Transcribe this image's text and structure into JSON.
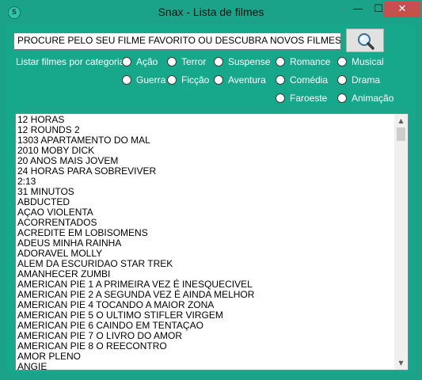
{
  "window": {
    "title": "Snax - Lista de filmes",
    "app_icon_glyph": "S",
    "minimize_glyph": "—",
    "maximize_glyph": "☐",
    "close_glyph": "✕"
  },
  "search": {
    "value": "PROCURE PELO SEU FILME FAVORITO OU DESCUBRA NOVOS FILMES!",
    "button_icon": "magnifier-icon"
  },
  "categories": {
    "label": "Listar filmes por categoria:",
    "options": [
      {
        "label": "Ação",
        "selected": false
      },
      {
        "label": "Terror",
        "selected": false
      },
      {
        "label": "Suspense",
        "selected": false
      },
      {
        "label": "Romance",
        "selected": false
      },
      {
        "label": "Musical",
        "selected": false
      },
      {
        "label": "Guerra",
        "selected": false
      },
      {
        "label": "Ficção",
        "selected": false
      },
      {
        "label": "Aventura",
        "selected": false
      },
      {
        "label": "Comédia",
        "selected": false
      },
      {
        "label": "Drama",
        "selected": false
      },
      {
        "label": "Faroeste",
        "selected": false
      },
      {
        "label": "Animação",
        "selected": false
      }
    ]
  },
  "movies": [
    "12 HORAS",
    "12 ROUNDS 2",
    "1303 APARTAMENTO DO MAL",
    "2010 MOBY DICK",
    "20 ANOS MAIS JOVEM",
    "24 HORAS PARA SOBREVIVER",
    "2:13",
    "31 MINUTOS",
    "ABDUCTED",
    "AÇAO VIOLENTA",
    "ACORRENTADOS",
    "ACREDITE EM LOBISOMENS",
    "ADEUS MINHA RAINHA",
    "ADORAVEL MOLLY",
    "ALEM DA ESCURIDAO STAR TREK",
    "AMANHECER ZUMBI",
    "AMERICAN PIE 1 A PRIMEIRA VEZ É INESQUECIVEL",
    "AMERICAN PIE 2 A SEGUNDA VEZ É AINDA MELHOR",
    "AMERICAN PIE 4 TOCANDO A MAIOR ZONA",
    "AMERICAN PIE 5 O ULTIMO STIFLER VIRGEM",
    "AMERICAN PIE 6 CAINDO EM TENTAÇAO",
    "AMERICAN PIE 7 O LIVRO DO AMOR",
    "AMERICAN PIE 8 O REECONTRO",
    "AMOR PLENO",
    "ANGIE"
  ],
  "scrollbar": {
    "up_glyph": "▲",
    "down_glyph": "▼"
  },
  "colors": {
    "accent": "#1ba38a",
    "close_button": "#c7504f"
  }
}
